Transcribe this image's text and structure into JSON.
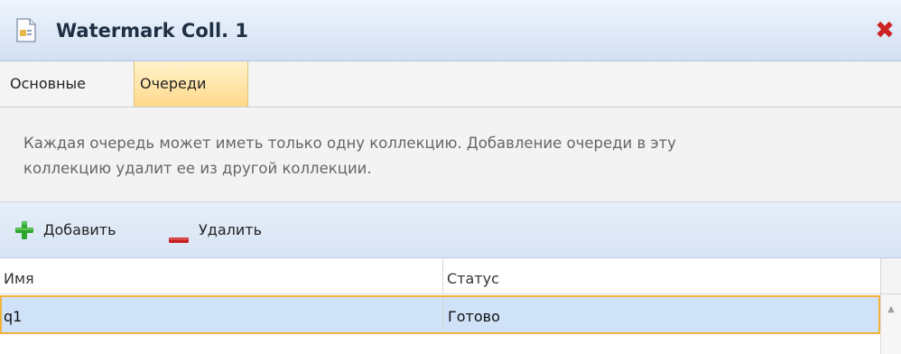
{
  "window": {
    "title": "Watermark Coll. 1",
    "doc_icon": "document-icon",
    "close_icon": "close-icon"
  },
  "tabs": [
    {
      "label": "Основные",
      "active": false
    },
    {
      "label": "Очереди",
      "active": true
    }
  ],
  "info": {
    "text_line1": "Каждая очередь может иметь только одну коллекцию. Добавление очереди в эту",
    "text_line2": "коллекцию удалит ее из другой коллекции."
  },
  "toolbar": {
    "add_label": "Добавить",
    "add_icon": "plus-icon",
    "delete_label": "Удалить",
    "delete_icon": "minus-icon"
  },
  "grid": {
    "columns": [
      "Имя",
      "Статус"
    ],
    "rows": [
      {
        "name": "q1",
        "status": "Готово",
        "selected": true
      }
    ]
  },
  "colors": {
    "accent_tab": "#ffd98a",
    "selection_fill": "#cfe2f7",
    "selection_border": "#f2b33a",
    "add_green": "#2ea62e",
    "delete_red": "#c42020"
  }
}
